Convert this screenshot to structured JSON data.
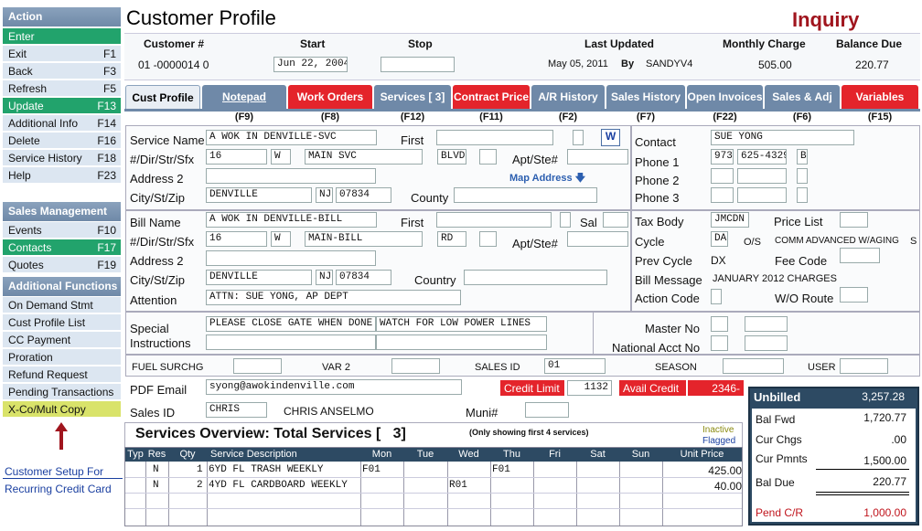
{
  "sidebar": {
    "action_header": "Action",
    "enter": "Enter",
    "items": [
      {
        "label": "Exit",
        "key": "F1"
      },
      {
        "label": "Back",
        "key": "F3"
      },
      {
        "label": "Refresh",
        "key": "F5"
      },
      {
        "label": "Update",
        "key": "F13"
      },
      {
        "label": "Additional Info",
        "key": "F14"
      },
      {
        "label": "Delete",
        "key": "F16"
      },
      {
        "label": "Service History",
        "key": "F18"
      },
      {
        "label": "Help",
        "key": "F23"
      }
    ],
    "sales_header": "Sales Management",
    "sales_items": [
      {
        "label": "Events",
        "key": "F10"
      },
      {
        "label": "Contacts",
        "key": "F17"
      },
      {
        "label": "Quotes",
        "key": "F19"
      }
    ],
    "additional_header": "Additional Functions",
    "additional_items": [
      {
        "label": "On Demand Stmt"
      },
      {
        "label": "Cust Profile List"
      },
      {
        "label": "CC Payment"
      },
      {
        "label": "Proration"
      },
      {
        "label": "Refund Request"
      },
      {
        "label": "Pending Transactions"
      },
      {
        "label": "X-Co/Mult Copy"
      }
    ],
    "link1": "Customer Setup For",
    "link2": "Recurring Credit Card"
  },
  "header": {
    "title": "Customer Profile",
    "mode": "Inquiry",
    "customer_label": "Customer #",
    "customer_value": "01 -0000014 0",
    "start_label": "Start",
    "start_value": "Jun 22, 2004",
    "stop_label": "Stop",
    "stop_value": "",
    "last_updated_label": "Last Updated",
    "last_updated_value": "May 05, 2011",
    "by_label": "By",
    "by_value": "SANDYV4",
    "monthly_label": "Monthly Charge",
    "monthly_value": "505.00",
    "balance_label": "Balance Due",
    "balance_value": "220.77"
  },
  "tabs": [
    {
      "label": "Cust Profile",
      "key": ""
    },
    {
      "label": "Notepad",
      "key": "(F9)"
    },
    {
      "label": "Work Orders",
      "key": "(F8)"
    },
    {
      "label": "Services [     3]",
      "key": "(F12)"
    },
    {
      "label": "Contract Price",
      "key": "(F11)"
    },
    {
      "label": "A/R History",
      "key": "(F2)"
    },
    {
      "label": "Sales History",
      "key": "(F7)"
    },
    {
      "label": "Open Invoices",
      "key": "(F22)"
    },
    {
      "label": "Sales & Adj",
      "key": "(F6)"
    },
    {
      "label": "Variables",
      "key": "(F15)"
    }
  ],
  "service": {
    "name_label": "Service Name",
    "name": "A WOK IN DENVILLE-SVC",
    "first_label": "First",
    "first": "",
    "addr_label": "#/Dir/Str/Sfx",
    "num": "16",
    "dir": "W",
    "street": "MAIN SVC",
    "sfx": "BLVD",
    "apt_label": "Apt/Ste#",
    "address2_label": "Address 2",
    "map_address": "Map Address",
    "city_label": "City/St/Zip",
    "city": "DENVILLE",
    "state": "NJ",
    "zip": "07834",
    "county_label": "County"
  },
  "contact": {
    "contact_label": "Contact",
    "contact": "SUE YONG",
    "phone1_label": "Phone 1",
    "phone1_area": "973",
    "phone1_num": "625-4329",
    "phone1_type": "B",
    "phone2_label": "Phone 2",
    "phone3_label": "Phone 3"
  },
  "bill": {
    "name_label": "Bill Name",
    "name": "A WOK IN DENVILLE-BILL",
    "first_label": "First",
    "sal_label": "Sal",
    "addr_label": "#/Dir/Str/Sfx",
    "num": "16",
    "dir": "W",
    "street": "MAIN-BILL",
    "sfx": "RD",
    "apt_label": "Apt/Ste#",
    "address2_label": "Address 2",
    "city_label": "City/St/Zip",
    "city": "DENVILLE",
    "state": "NJ",
    "zip": "07834",
    "country_label": "Country",
    "attention_label": "Attention",
    "attention": "ATTN: SUE YONG, AP DEPT"
  },
  "tax": {
    "tax_body_label": "Tax Body",
    "tax_body": "JMCDN",
    "price_list_label": "Price List",
    "cycle_label": "Cycle",
    "cycle": "DA",
    "os_label": "O/S",
    "os_value": "COMM ADVANCED W/AGING",
    "os_code": "S",
    "prev_cycle_label": "Prev Cycle",
    "prev_cycle": "DX",
    "fee_code_label": "Fee Code",
    "bill_message_label": "Bill Message",
    "bill_message": "JANUARY 2012 CHARGES",
    "action_code_label": "Action Code",
    "wo_route_label": "W/O Route"
  },
  "special": {
    "label1": "Special",
    "label2": "Instructions",
    "text1": "PLEASE CLOSE GATE WHEN DONE",
    "text2": "WATCH FOR LOW POWER LINES",
    "master_label": "Master No",
    "national_label": "National Acct No"
  },
  "misc": {
    "fuel": "FUEL SURCHG",
    "var2": "VAR 2",
    "sales_id": "SALES ID",
    "sales_id_value": "01",
    "season": "SEASON",
    "user": "USER"
  },
  "email": {
    "label": "PDF Email",
    "value": "syong@awokindenville.com",
    "credit_limit_label": "Credit Limit",
    "credit_limit": "1132",
    "avail_credit_label": "Avail Credit",
    "avail_credit": "2346-"
  },
  "sales": {
    "label": "Sales ID",
    "id": "CHRIS",
    "name": "CHRIS ANSELMO",
    "muni_label": "Muni#"
  },
  "services_overview": {
    "title": "Services Overview: Total Services [",
    "count": "3]",
    "note": "(Only showing first 4 services)",
    "inactive": "Inactive",
    "flagged": "Flagged",
    "columns": [
      "Typ",
      "Res",
      "Qty",
      "Service Description",
      "Mon",
      "Tue",
      "Wed",
      "Thu",
      "Fri",
      "Sat",
      "Sun",
      "Unit Price"
    ],
    "rows": [
      {
        "res": "N",
        "qty": "1",
        "desc": "6YD FL TRASH WEEKLY",
        "mon": "F01",
        "wed": "",
        "thu": "F01",
        "price": "425.00"
      },
      {
        "res": "N",
        "qty": "2",
        "desc": "4YD FL CARDBOARD WEEKLY",
        "mon": "",
        "wed": "R01",
        "thu": "",
        "price": "40.00"
      }
    ]
  },
  "unbilled": {
    "label": "Unbilled",
    "value": "3,257.28",
    "bal_fwd_label": "Bal Fwd",
    "bal_fwd": "1,720.77",
    "cur_chgs_label": "Cur Chgs",
    "cur_chgs": ".00",
    "cur_pmnts_label": "Cur Pmnts",
    "cur_pmnts": "1,500.00",
    "bal_due_label": "Bal Due",
    "bal_due": "220.77",
    "pend_label": "Pend C/R",
    "pend": "1,000.00"
  },
  "colors": {
    "accent": "#6f89a8",
    "red": "#e4242b",
    "green": "#22a36c",
    "dark": "#2d4a63"
  }
}
